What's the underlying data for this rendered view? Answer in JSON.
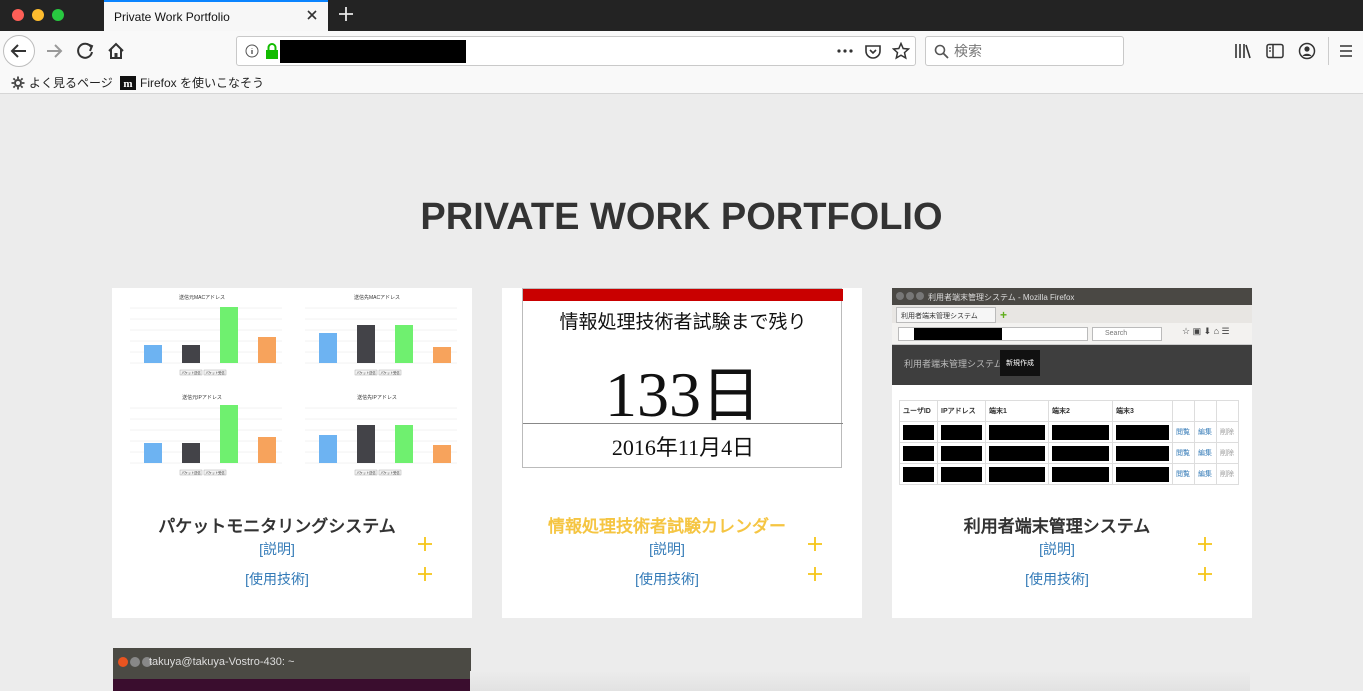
{
  "browser": {
    "tab_title": "Private Work Portfolio",
    "search_placeholder": "検索",
    "bookmarks": [
      {
        "label": "よく見るページ"
      },
      {
        "label": "Firefox を使いこなそう"
      }
    ],
    "accent_color": "#0a84ff"
  },
  "page": {
    "heading": "PRIVATE WORK PORTFOLIO",
    "background": "#ececec",
    "link_color": "#337ab7",
    "plus_color": "#f5c518"
  },
  "cards": [
    {
      "title": "パケットモニタリングシステム",
      "link_description": "[説明]",
      "link_tech": "[使用技術]",
      "thumb_charts": [
        {
          "title": "送信元MACアドレス",
          "values": [
            180,
            180,
            560,
            260
          ]
        },
        {
          "title": "送信先MACアドレス",
          "values": [
            300,
            380,
            380,
            160
          ]
        },
        {
          "title": "送信元IPアドレス",
          "values": [
            200,
            200,
            580,
            260
          ]
        },
        {
          "title": "送信先IPアドレス",
          "values": [
            280,
            380,
            380,
            180
          ]
        }
      ],
      "thumb_button_labels": [
        "パケット送信",
        "パケット受信"
      ]
    },
    {
      "title": "情報処理技術者試験カレンダー",
      "title_color": "#f5c542",
      "link_description": "[説明]",
      "link_tech": "[使用技術]",
      "calendar": {
        "heading": "情報処理技術者試験まで残り",
        "days": "133",
        "day_unit": "日",
        "date": "2016年11月4日"
      }
    },
    {
      "title": "利用者端末管理システム",
      "link_description": "[説明]",
      "link_tech": "[使用技術]",
      "thumb": {
        "window_title": "利用者端末管理システム - Mozilla Firefox",
        "tab_label": "利用者端末管理システム",
        "search_label": "Search",
        "app_name": "利用者端末管理システム",
        "new_button": "新規作成",
        "columns": [
          "ユーザID",
          "IPアドレス",
          "端末1",
          "端末2",
          "端末3",
          "",
          "",
          ""
        ],
        "actions": [
          "閲覧",
          "編集",
          "削除"
        ]
      }
    }
  ],
  "terminal": {
    "title": "takuya@takuya-Vostro-430: ~"
  }
}
